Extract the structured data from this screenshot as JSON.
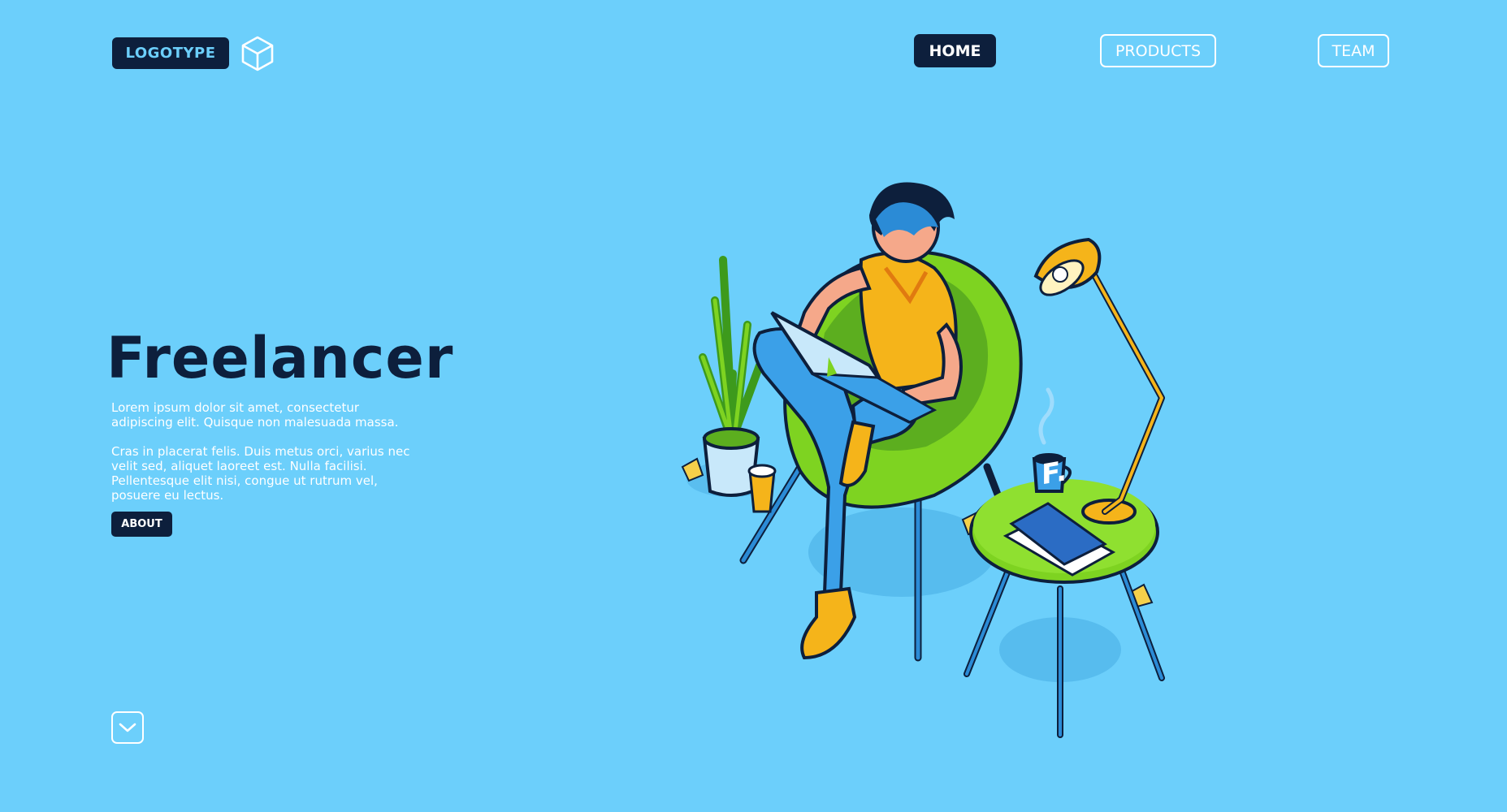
{
  "header": {
    "logo_label": "LOGOTYPE",
    "logo_icon": "cube-icon",
    "nav": [
      {
        "label": "HOME",
        "active": true
      },
      {
        "label": "PRODUCTS",
        "active": false
      },
      {
        "label": "TEAM",
        "active": false
      }
    ]
  },
  "hero": {
    "title": "Freelancer",
    "paragraph1": "Lorem ipsum dolor sit amet, consectetur adipiscing elit. Quisque non malesuada massa.",
    "paragraph2": "Cras in placerat felis. Duis metus orci, varius nec velit sed, aliquet laoreet est. Nulla facilisi. Pellentesque elit nisi, congue ut rutrum vel, posuere eu lectus.",
    "about_label": "ABOUT"
  },
  "scroll_icon": "chevron-down-icon",
  "illustration": {
    "name": "freelancer-illustration",
    "document_letter": "F."
  },
  "colors": {
    "background": "#6ccffb",
    "dark": "#0d1f3c",
    "white": "#ffffff",
    "green": "#7ed321",
    "yellow": "#f5b41a"
  }
}
